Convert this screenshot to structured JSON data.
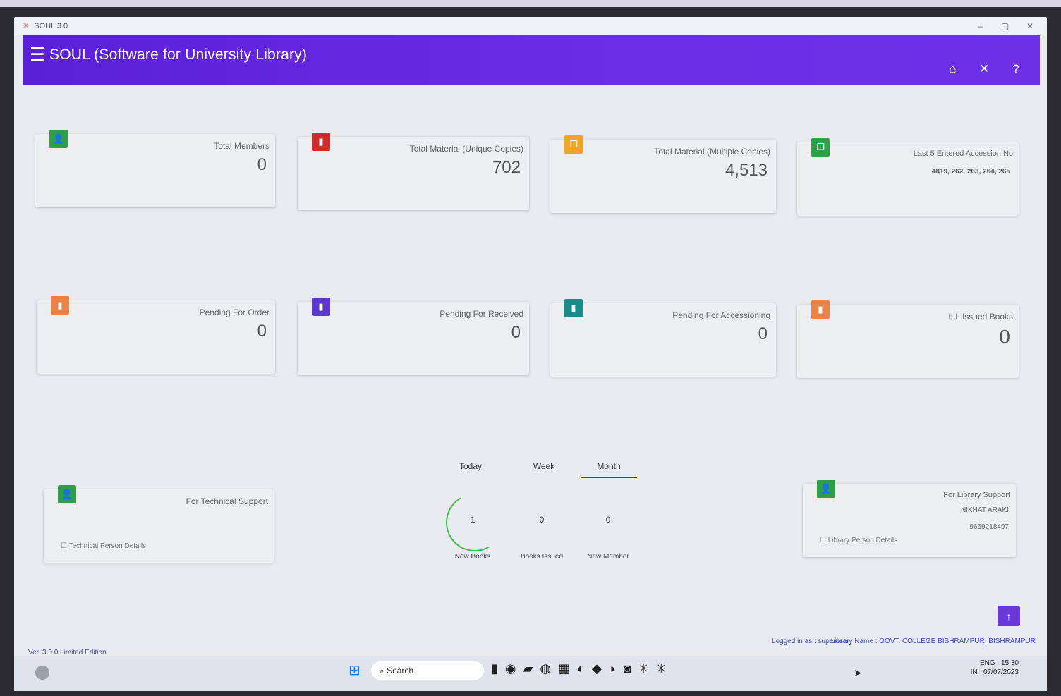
{
  "window": {
    "title": "SOUL 3.0",
    "controls": [
      "–",
      "▢",
      "✕"
    ]
  },
  "appbar": {
    "title": "SOUL (Software for University Library)",
    "menu_icon": "☰",
    "actions": [
      "⌂",
      "✕",
      "?"
    ]
  },
  "cards_row1": [
    {
      "label": "Total Members",
      "value": "0",
      "color": "#2e9e48",
      "icon": "person-icon"
    },
    {
      "label": "Total Material (Unique Copies)",
      "value": "702",
      "color": "#d02b2b",
      "icon": "document-icon"
    },
    {
      "label": "Total Material (Multiple Copies)",
      "value": "4,513",
      "color": "#f0a42c",
      "icon": "copy-icon"
    },
    {
      "label": "Last 5 Entered Accession No",
      "value": "4819, 262, 263, 264, 265",
      "color": "#2e9e48",
      "icon": "copy-icon"
    }
  ],
  "cards_row2": [
    {
      "label": "Pending For Order",
      "value": "0",
      "color": "#e8834a",
      "icon": "book-icon"
    },
    {
      "label": "Pending For Received",
      "value": "0",
      "color": "#5a38d0",
      "icon": "book-icon"
    },
    {
      "label": "Pending For Accessioning",
      "value": "0",
      "color": "#1a8c8a",
      "icon": "book-icon"
    },
    {
      "label": "ILL Issued Books",
      "value": "0",
      "color": "#e8834a",
      "icon": "book-icon"
    }
  ],
  "support_tech": {
    "label": "For Technical Support",
    "detail": "☐ Technical Person Details",
    "color": "#2e9e48"
  },
  "support_lib": {
    "label": "For Library Support",
    "name": "NIKHAT ARAKI",
    "phone": "9669218497",
    "detail": "☐ Library Person Details",
    "color": "#2e9e48"
  },
  "tabs": {
    "today": "Today",
    "week": "Week",
    "month": "Month",
    "active": "Month"
  },
  "stats": [
    {
      "value": "1",
      "caption": "New Books"
    },
    {
      "value": "0",
      "caption": "Books Issued"
    },
    {
      "value": "0",
      "caption": "New Member"
    }
  ],
  "fab_icon": "↑",
  "footer": {
    "version": "Ver. 3.0.0  Limited Edition",
    "logged": "Logged in as : superuser",
    "library": "Library Name : GOVT. COLLEGE BISHRAMPUR, BISHRAMPUR"
  },
  "taskbar": {
    "search": "Search",
    "lang": "ENG",
    "region": "IN",
    "time": "15:30",
    "date": "07/07/2023"
  }
}
